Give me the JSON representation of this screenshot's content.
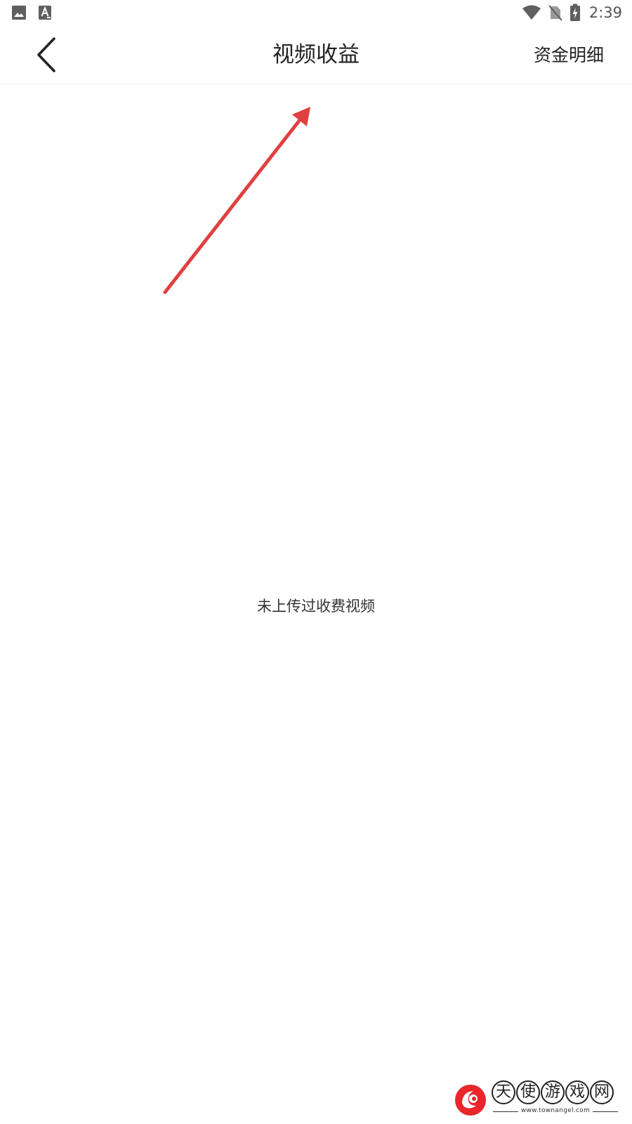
{
  "status_bar": {
    "time": "2:39",
    "left_icons": [
      "image-icon",
      "font-icon"
    ],
    "right_icons": [
      "wifi-icon",
      "no-sim-icon",
      "battery-charging-icon"
    ]
  },
  "nav": {
    "back_icon": "chevron-left-icon",
    "title": "视频收益",
    "right_action": "资金明细"
  },
  "content": {
    "empty_message": "未上传过收费视频"
  },
  "watermark": {
    "chars": [
      "天",
      "使",
      "游",
      "戏",
      "网"
    ],
    "url": "www.townangel.com"
  },
  "colors": {
    "background": "#ffffff",
    "text": "#222222",
    "annotation_arrow": "#e0403f",
    "watermark_red": "#e8262b",
    "divider": "#ececec"
  }
}
